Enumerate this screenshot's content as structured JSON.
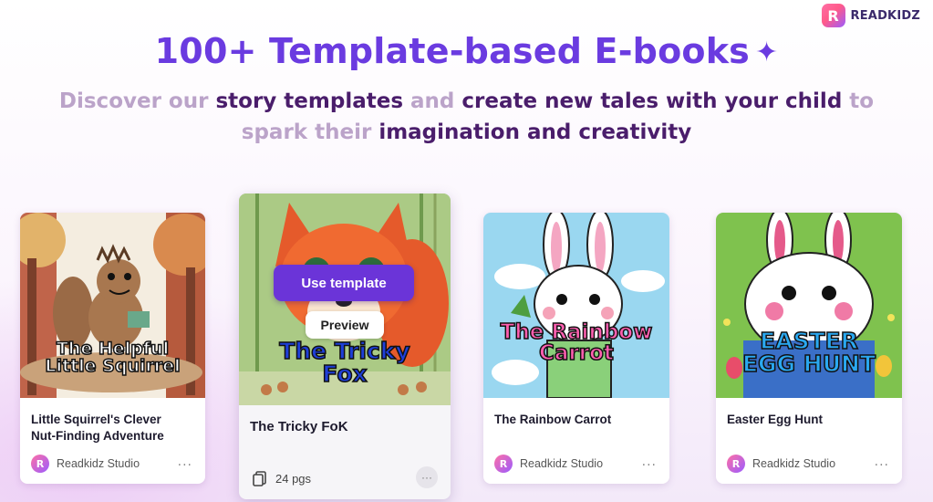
{
  "brand": {
    "logo_letter": "R",
    "name": "READKIDZ",
    "color": "#3b2a6b"
  },
  "hero": {
    "headline": "100+ Template-based E-books",
    "sparkle_icon": "sparkle-icon",
    "subtitle_parts": [
      {
        "text": "Discover our ",
        "emphasis": false
      },
      {
        "text": "story templates",
        "emphasis": true
      },
      {
        "text": " and ",
        "emphasis": false
      },
      {
        "text": "create new tales with your child",
        "emphasis": true
      },
      {
        "text": " to spark their ",
        "emphasis": false
      },
      {
        "text": "imagination and creativity",
        "emphasis": true
      }
    ]
  },
  "cards": [
    {
      "cover_title_line1": "The Helpful",
      "cover_title_line2": "Little Squirrel",
      "title_line1": "Little Squirrel's Clever",
      "title_line2": "Nut-Finding Adventure",
      "author": "Readkidz Studio",
      "more": "···"
    },
    {
      "cover_title_line1": "The Tricky",
      "cover_title_line2": "Fox",
      "title": "The Tricky FoK",
      "use_template_label": "Use template",
      "preview_label": "Preview",
      "pages": "24 pgs",
      "more": "···"
    },
    {
      "cover_title_line1": "The Rainbow",
      "cover_title_line2": "Carrot",
      "title": "The Rainbow Carrot",
      "author": "Readkidz Studio",
      "more": "···"
    },
    {
      "cover_title_line1": "EASTER",
      "cover_title_line2": "EGG HUNT",
      "title": "Easter Egg Hunt",
      "author": "Readkidz Studio",
      "more": "···"
    }
  ],
  "colors": {
    "accent": "#6a3be0",
    "button": "#6b34d8",
    "subtitle_muted": "#bba3c9",
    "subtitle_emphasis": "#4a1d6b"
  }
}
